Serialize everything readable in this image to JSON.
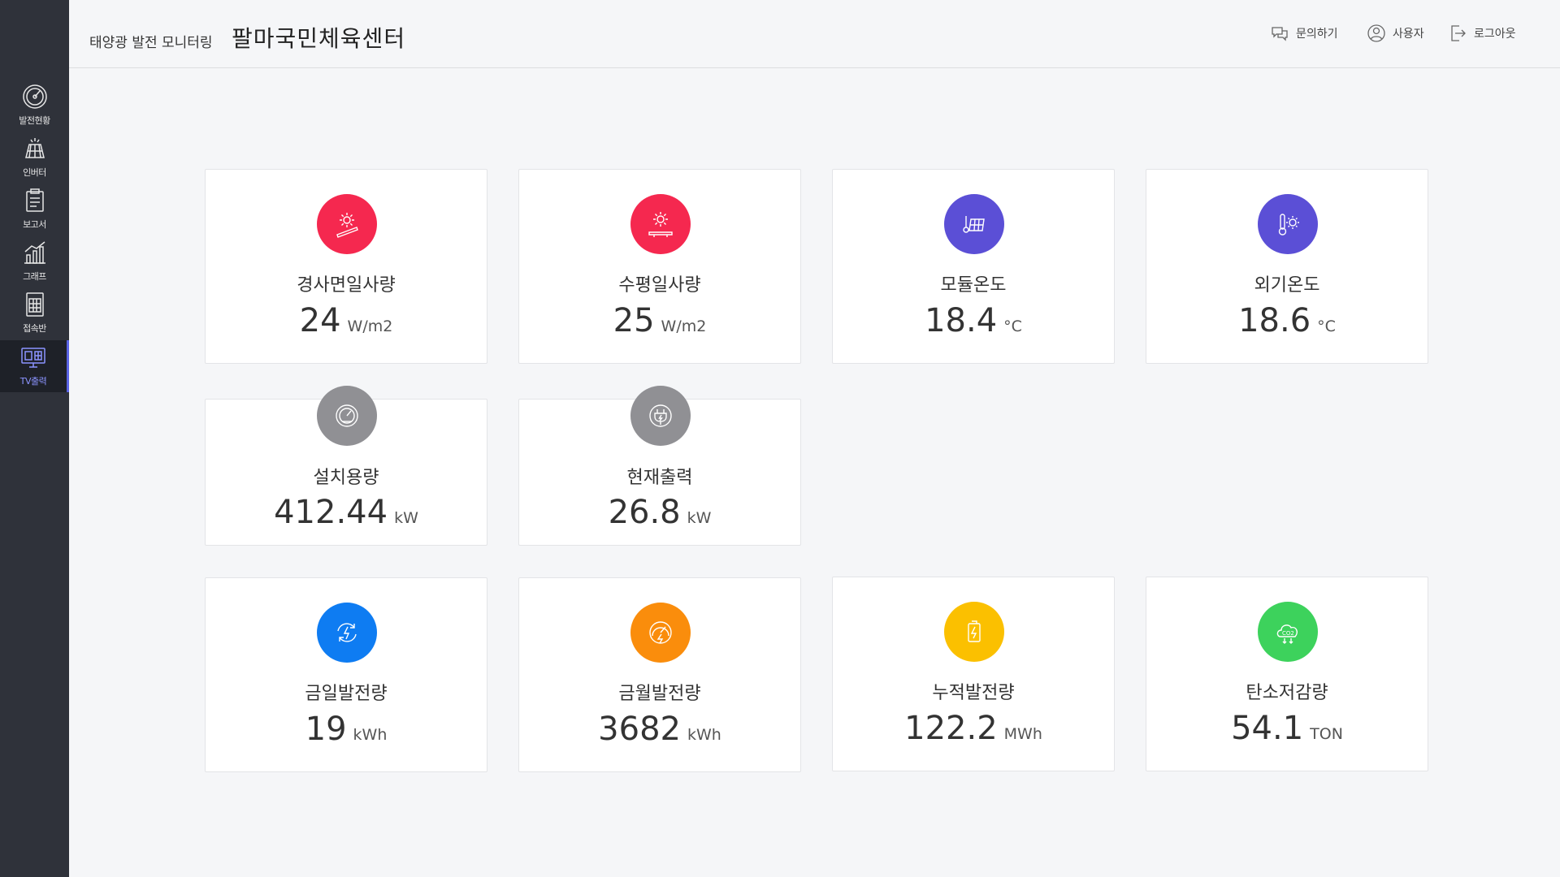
{
  "header": {
    "subtitle": "태양광 발전 모니터링",
    "title": "팔마국민체육센터",
    "buttons": {
      "inquiry": "문의하기",
      "user": "사용자",
      "logout": "로그아웃"
    }
  },
  "sidebar": {
    "items": [
      {
        "label": "발전현황",
        "icon": "gauge-icon"
      },
      {
        "label": "인버터",
        "icon": "solar-panel-icon"
      },
      {
        "label": "보고서",
        "icon": "clipboard-icon"
      },
      {
        "label": "그래프",
        "icon": "chart-icon"
      },
      {
        "label": "접속반",
        "icon": "grid-box-icon"
      },
      {
        "label": "TV출력",
        "icon": "tv-icon"
      }
    ],
    "active": "TV출력"
  },
  "cards": {
    "inclined_irradiance": {
      "label": "경사면일사량",
      "value": "24",
      "unit": "W/m2",
      "color": "#f5284f"
    },
    "horizontal_irradiance": {
      "label": "수평일사량",
      "value": "25",
      "unit": "W/m2",
      "color": "#f5284f"
    },
    "module_temp": {
      "label": "모듈온도",
      "value": "18.4",
      "unit": "°C",
      "color": "#5b4fd6"
    },
    "outdoor_temp": {
      "label": "외기온도",
      "value": "18.6",
      "unit": "°C",
      "color": "#5b4fd6"
    },
    "capacity": {
      "label": "설치용량",
      "value": "412.44",
      "unit": "kW",
      "color": "#909094"
    },
    "current_output": {
      "label": "현재출력",
      "value": "26.8",
      "unit": "kW",
      "color": "#909094"
    },
    "today_gen": {
      "label": "금일발전량",
      "value": "19",
      "unit": "kWh",
      "color": "#0e7cf2"
    },
    "month_gen": {
      "label": "금월발전량",
      "value": "3682",
      "unit": "kWh",
      "color": "#fa8d0c"
    },
    "total_gen": {
      "label": "누적발전량",
      "value": "122.2",
      "unit": "MWh",
      "color": "#fbc000"
    },
    "carbon": {
      "label": "탄소저감량",
      "value": "54.1",
      "unit": "TON",
      "color": "#3dd25c"
    }
  }
}
